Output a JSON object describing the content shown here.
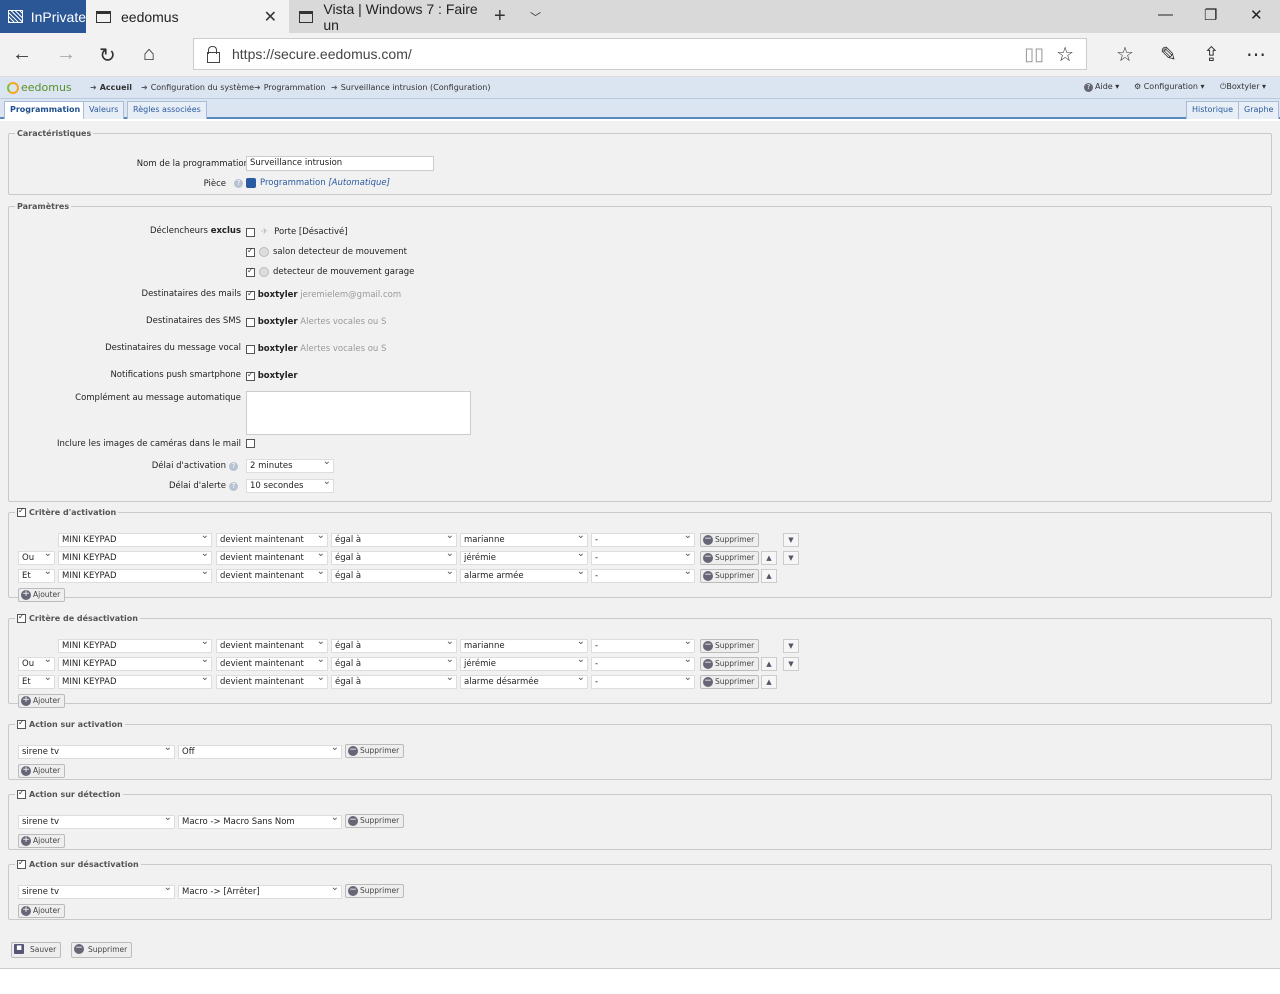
{
  "browser": {
    "private_label": "InPrivate",
    "tab_active": "eedomus",
    "tab_other": "Vista | Windows 7 : Faire un",
    "url": "https://secure.eedomus.com/"
  },
  "app": {
    "logo": "eedomus",
    "breadcrumb": [
      "Accueil",
      "Configuration du système",
      "Programmation",
      "Surveillance intrusion (Configuration)"
    ],
    "menu": {
      "help": "Aide",
      "config": "Configuration",
      "user": "Boxtyler"
    },
    "tabs": [
      "Programmation",
      "Valeurs",
      "Règles associées"
    ],
    "right_tabs": [
      "Historique",
      "Graphe"
    ]
  },
  "carac": {
    "legend": "Caractéristiques",
    "name_label": "Nom de la programmation",
    "name_value": "Surveillance intrusion",
    "piece_label": "Pièce",
    "piece_value": "Programmation",
    "piece_auto": "[Automatique]"
  },
  "params": {
    "legend": "Paramètres",
    "triggers_label": "Déclencheurs",
    "triggers_bold": "exclus",
    "triggers": [
      {
        "label": "Porte [Désactivé]",
        "checked": false
      },
      {
        "label": "salon detecteur de mouvement",
        "checked": true
      },
      {
        "label": "detecteur de mouvement garage",
        "checked": true
      }
    ],
    "mails_label": "Destinataires des mails",
    "mails_user": "boxtyler",
    "mails_extra": "jeremielem@gmail.com",
    "sms_label": "Destinataires des SMS",
    "sms_user": "boxtyler",
    "sms_extra": "Alertes vocales ou S",
    "voice_label": "Destinataires du message vocal",
    "voice_user": "boxtyler",
    "voice_extra": "Alertes vocales ou S",
    "push_label": "Notifications push smartphone",
    "push_user": "boxtyler",
    "complement_label": "Complément au message automatique",
    "images_label": "Inclure les images de caméras dans le mail",
    "delay_act_label": "Délai d'activation",
    "delay_act": "2 minutes",
    "delay_alert_label": "Délai d'alerte",
    "delay_alert": "10 secondes"
  },
  "activation": {
    "legend": "Critère d'activation",
    "rows": [
      {
        "op": "",
        "device": "MINI KEYPAD",
        "verb": "devient maintenant",
        "cmp": "égal à",
        "value": "marianne",
        "extra": "-"
      },
      {
        "op": "Ou",
        "device": "MINI KEYPAD",
        "verb": "devient maintenant",
        "cmp": "égal à",
        "value": "jérémie",
        "extra": "-"
      },
      {
        "op": "Et",
        "device": "MINI KEYPAD",
        "verb": "devient maintenant",
        "cmp": "égal à",
        "value": "alarme armée",
        "extra": "-"
      }
    ]
  },
  "deactivation": {
    "legend": "Critère de désactivation",
    "rows": [
      {
        "op": "",
        "device": "MINI KEYPAD",
        "verb": "devient maintenant",
        "cmp": "égal à",
        "value": "marianne",
        "extra": "-"
      },
      {
        "op": "Ou",
        "device": "MINI KEYPAD",
        "verb": "devient maintenant",
        "cmp": "égal à",
        "value": "jérémie",
        "extra": "-"
      },
      {
        "op": "Et",
        "device": "MINI KEYPAD",
        "verb": "devient maintenant",
        "cmp": "égal à",
        "value": "alarme désarmée",
        "extra": "-"
      }
    ]
  },
  "act_on": {
    "legend": "Action sur activation",
    "device": "sirene tv",
    "action": "Off"
  },
  "act_detect": {
    "legend": "Action sur détection",
    "device": "sirene tv",
    "action": "Macro -> Macro Sans Nom"
  },
  "act_off": {
    "legend": "Action sur désactivation",
    "device": "sirene tv",
    "action": "Macro -> [Arrêter]"
  },
  "labels": {
    "delete": "Supprimer",
    "add": "Ajouter",
    "save": "Sauver"
  }
}
